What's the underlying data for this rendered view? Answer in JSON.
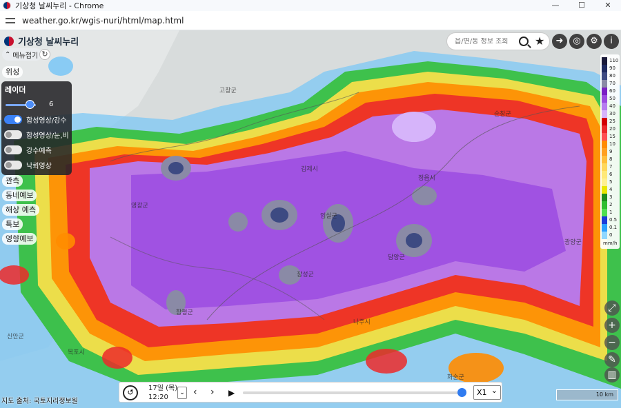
{
  "window": {
    "title": "기상청 날씨누리 - Chrome",
    "controls": [
      "—",
      "☐",
      "✕"
    ]
  },
  "address": {
    "url": "weather.go.kr/wgis-nuri/html/map.html"
  },
  "app": {
    "logo_text": "기상청 날씨누리",
    "menu_toggle": "메뉴접기",
    "chips": {
      "satellite": "위성",
      "observation": "관측",
      "local_forecast": "동네예보",
      "marine_forecast": "해상 예측",
      "warnings": "특보",
      "impact_forecast": "영향예보"
    }
  },
  "layer_panel": {
    "title": "레이더",
    "opacity_value": "6",
    "opacity_fraction": 0.6,
    "toggles": [
      {
        "label": "합성영상/강수",
        "on": true
      },
      {
        "label": "합성영상/눈,비",
        "on": false
      },
      {
        "label": "강수예측",
        "on": false
      },
      {
        "label": "낙뢰영상",
        "on": false
      }
    ]
  },
  "search": {
    "placeholder": "읍/면/동 정보 조회"
  },
  "legend": {
    "unit": "mm/h",
    "items": [
      {
        "label": "110",
        "color": "#1a1a3a"
      },
      {
        "label": "90",
        "color": "#1f2a60"
      },
      {
        "label": "80",
        "color": "#3d4a82"
      },
      {
        "label": "70",
        "color": "#8a8aa6"
      },
      {
        "label": "60",
        "color": "#7a1fc4"
      },
      {
        "label": "50",
        "color": "#9b4be0"
      },
      {
        "label": "40",
        "color": "#b67cf0"
      },
      {
        "label": "30",
        "color": "#d6b4fa"
      },
      {
        "label": "25",
        "color": "#d20000"
      },
      {
        "label": "20",
        "color": "#ec2a2a"
      },
      {
        "label": "15",
        "color": "#ff5050"
      },
      {
        "label": "10",
        "color": "#ff8c00"
      },
      {
        "label": "9",
        "color": "#ffa020"
      },
      {
        "label": "8",
        "color": "#ffbf3a"
      },
      {
        "label": "7",
        "color": "#ffd85a"
      },
      {
        "label": "6",
        "color": "#ffe978"
      },
      {
        "label": "5",
        "color": "#fff090"
      },
      {
        "label": "4",
        "color": "#e9e600"
      },
      {
        "label": "3",
        "color": "#1e8c1e"
      },
      {
        "label": "2",
        "color": "#2fbe2f"
      },
      {
        "label": "1",
        "color": "#4fe04f"
      },
      {
        "label": "0.5",
        "color": "#1a3cd9"
      },
      {
        "label": "0.1",
        "color": "#2aa0ff"
      },
      {
        "label": "0",
        "color": "#8fd8ff"
      }
    ]
  },
  "places": [
    "고창군",
    "순창군",
    "김제시",
    "정읍시",
    "임실군",
    "영광군",
    "장성군",
    "담양군",
    "함평군",
    "화순군",
    "신안군",
    "나주시",
    "목포시",
    "광양군"
  ],
  "time_bar": {
    "date": "17일 (목)",
    "time": "12:20",
    "speed": "X1",
    "progress": 0.98
  },
  "footer": {
    "source": "지도 출처: 국토지리정보원",
    "scale": "10 km"
  }
}
